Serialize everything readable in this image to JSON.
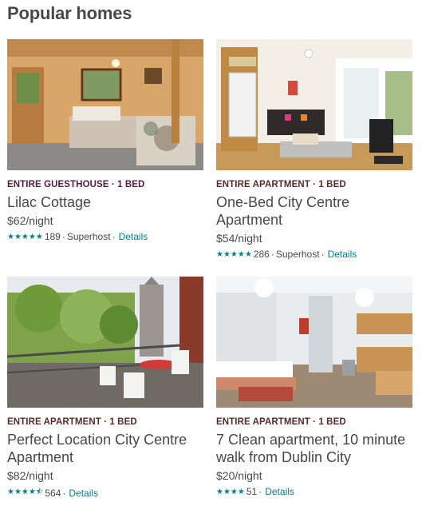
{
  "section": {
    "title": "Popular homes"
  },
  "listings": [
    {
      "type": "ENTIRE GUESTHOUSE · 1 BED",
      "title": "Lilac Cottage",
      "price": "$62/night",
      "stars": "★★★★★",
      "rating_value": 5,
      "reviews": "189",
      "badge": "Superhost",
      "link": "Details"
    },
    {
      "type": "ENTIRE APARTMENT · 1 BED",
      "title": "One-Bed City Centre Apartment",
      "price": "$54/night",
      "stars": "★★★★★",
      "rating_value": 5,
      "reviews": "286",
      "badge": "Superhost",
      "link": "Details"
    },
    {
      "type": "ENTIRE APARTMENT · 1 BED",
      "title": "Perfect Location City Centre Apartment",
      "price": "$82/night",
      "stars": "★★★★⯪",
      "rating_value": 4.5,
      "reviews": "564",
      "link": "Details"
    },
    {
      "type": "ENTIRE APARTMENT · 1 BED",
      "title": "7 Clean apartment, 10 minute walk from Dublin City",
      "price": "$20/night",
      "stars": "★★★★",
      "rating_value": 4,
      "reviews": "51",
      "link": "Details"
    }
  ],
  "colors": {
    "accent": "#008489",
    "type_label": "#5a2a2a",
    "text": "#484848"
  }
}
